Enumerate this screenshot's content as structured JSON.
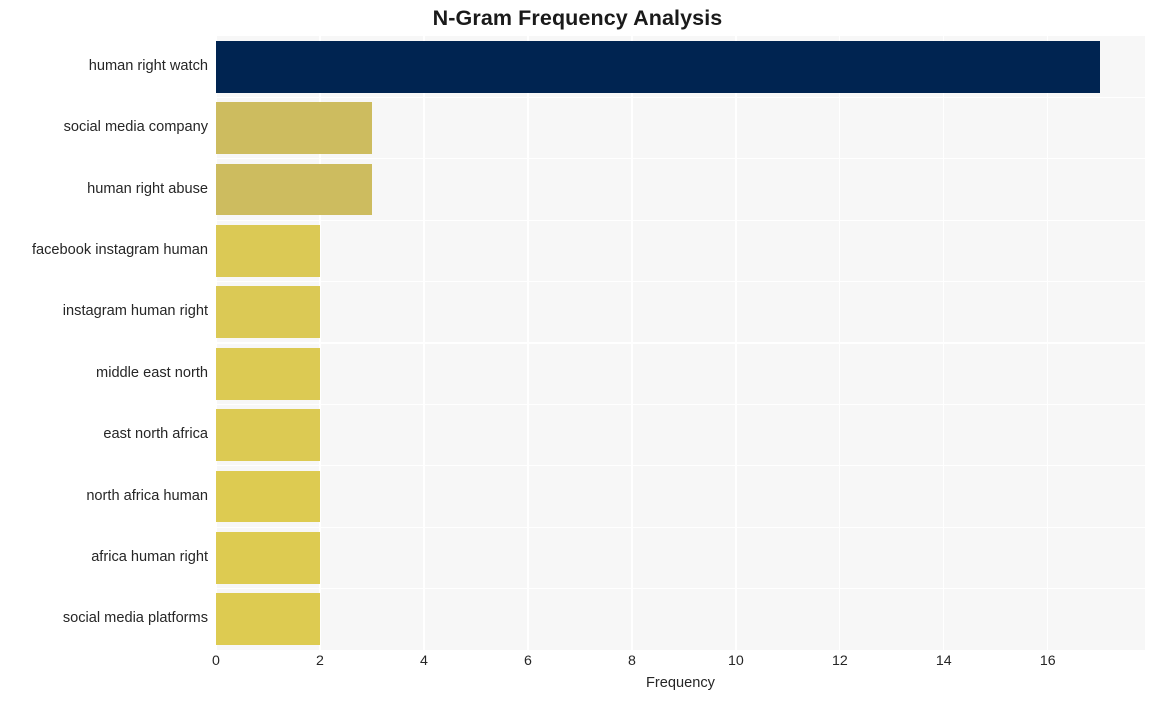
{
  "chart_data": {
    "type": "bar",
    "orientation": "horizontal",
    "title": "N-Gram Frequency Analysis",
    "xlabel": "Frequency",
    "ylabel": "",
    "categories": [
      "human right watch",
      "social media company",
      "human right abuse",
      "facebook instagram human",
      "instagram human right",
      "middle east north",
      "east north africa",
      "north africa human",
      "africa human right",
      "social media platforms"
    ],
    "values": [
      17,
      3,
      3,
      2,
      2,
      2,
      2,
      2,
      2,
      2
    ],
    "bar_colors": [
      "#002451",
      "#cdbc5f",
      "#cdbc5f",
      "#dbc955",
      "#dbc955",
      "#dcca53",
      "#dcca53",
      "#ddcb51",
      "#ddcb51",
      "#ddcb51"
    ],
    "xlim": [
      0,
      17.87
    ],
    "xticks": [
      0,
      2,
      4,
      6,
      8,
      10,
      12,
      14,
      16
    ],
    "xtick_labels": [
      "0",
      "2",
      "4",
      "6",
      "8",
      "10",
      "12",
      "14",
      "16"
    ],
    "grid": true,
    "grid_color": "#ffffff",
    "plot_background": "#f7f7f7",
    "figure_background": "#ffffff",
    "legend": null
  }
}
